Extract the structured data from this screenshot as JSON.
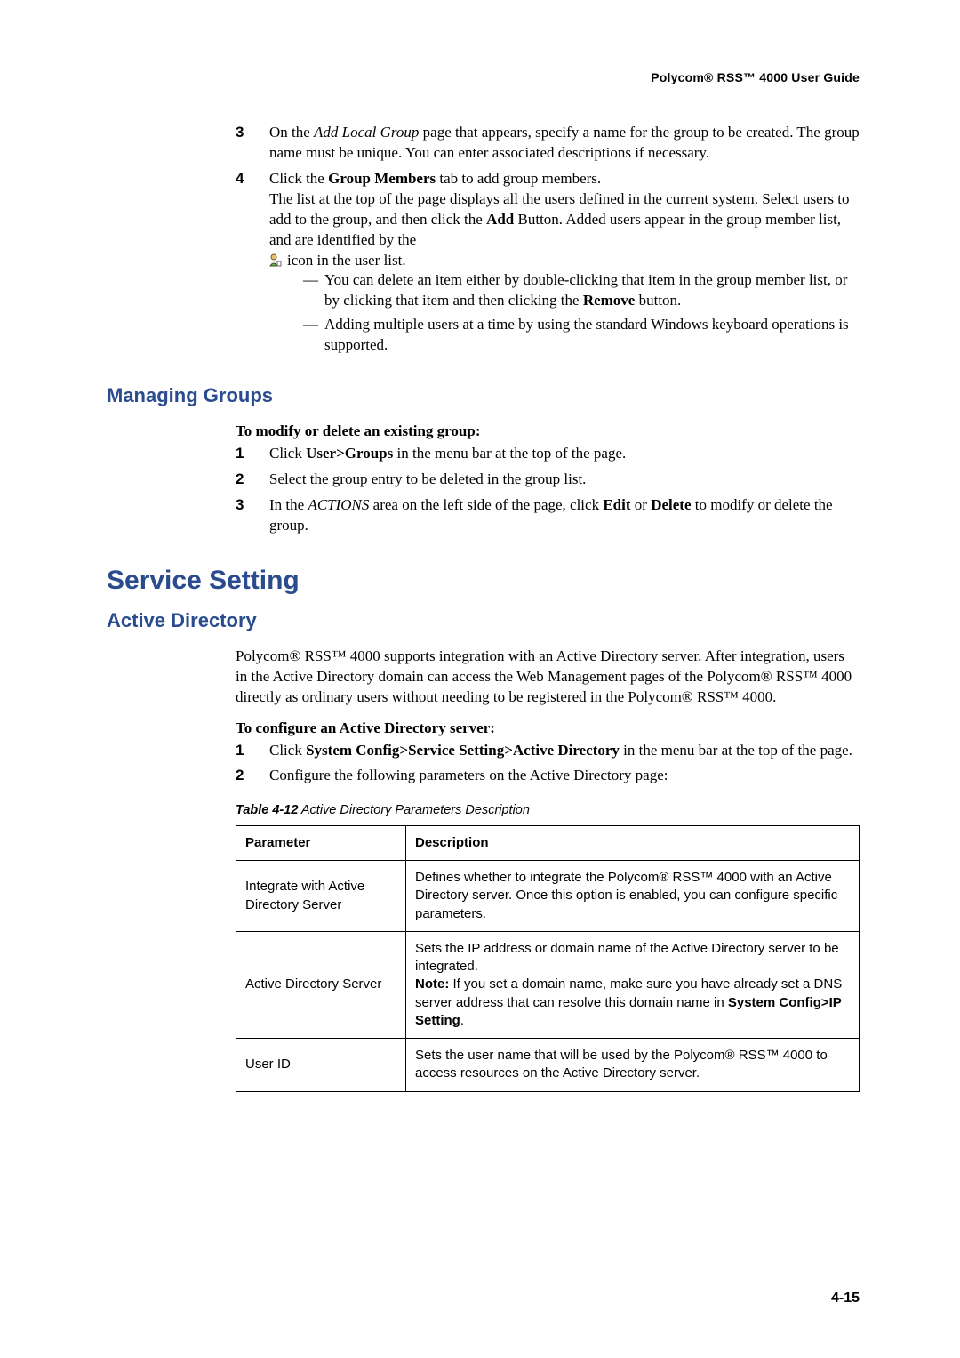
{
  "header": {
    "title": "Polycom® RSS™ 4000 User Guide"
  },
  "steps_top": {
    "s3": {
      "num": "3",
      "text_a": "On the ",
      "italic": "Add Local Group",
      "text_b": " page that appears, specify a name for the group to be created. The group name must be unique. You can enter associated descriptions if necessary."
    },
    "s4": {
      "num": "4",
      "line1_a": "Click the ",
      "line1_bold": "Group Members",
      "line1_b": " tab to add group members.",
      "line2_a": "The list at the top of the page displays all the users defined in the current system. Select users to add to the group, and then click the ",
      "line2_bold": "Add",
      "line2_b": " Button. Added users appear in the group member list, and are identified by the",
      "line3": "icon in the user list.",
      "bullet1_a": "You can delete an item either by double-clicking that item in the group member list, or by clicking that item and then clicking the ",
      "bullet1_bold": "Remove",
      "bullet1_b": " button.",
      "bullet2": "Adding multiple users at a time by using the standard Windows keyboard operations is supported."
    }
  },
  "managing_groups": {
    "heading": "Managing Groups",
    "lead": "To modify or delete an existing group:",
    "s1": {
      "num": "1",
      "a": "Click ",
      "bold": "User>Groups",
      "b": " in the menu bar at the top of the page."
    },
    "s2": {
      "num": "2",
      "text": "Select the group entry to be deleted in the group list."
    },
    "s3": {
      "num": "3",
      "a": "In the ",
      "italic": "ACTIONS",
      "b": " area on the left side of the page, click ",
      "bold1": "Edit",
      "mid": " or ",
      "bold2": "Delete",
      "c": " to modify or delete the group."
    }
  },
  "service_setting": {
    "chapter": "Service Setting",
    "active_directory_heading": "Active Directory",
    "intro": "Polycom® RSS™ 4000 supports integration with an Active Directory server. After integration, users in the Active Directory domain can access the Web Management pages of the Polycom® RSS™ 4000 directly as ordinary users without needing to be registered in the Polycom® RSS™ 4000.",
    "lead": "To configure an Active Directory server:",
    "s1": {
      "num": "1",
      "a": "Click ",
      "bold": "System Config>Service Setting>Active Directory",
      "b": " in the menu bar at the top of the page."
    },
    "s2": {
      "num": "2",
      "text": "Configure the following parameters on the Active Directory page:"
    }
  },
  "table": {
    "caption_bold": "Table 4-12",
    "caption_rest": " Active Directory Parameters Description",
    "head_param": "Parameter",
    "head_desc": "Description",
    "rows": [
      {
        "param": "Integrate with Active Directory Server",
        "desc": "Defines whether to integrate the Polycom® RSS™ 4000 with an Active Directory server. Once this option is enabled, you can configure specific parameters."
      },
      {
        "param": "Active Directory Server",
        "desc_a": "Sets the IP address or domain name of the Active Directory server to be integrated.",
        "note_label": "Note:",
        "desc_b": " If you set a domain name, make sure you have already set a DNS server address that can resolve this domain name in ",
        "bold_tail": "System Config>IP Setting",
        "period": "."
      },
      {
        "param": "User ID",
        "desc": "Sets the user name that will be used by the Polycom® RSS™ 4000 to access resources on the Active Directory server."
      }
    ]
  },
  "page_number": "4-15"
}
